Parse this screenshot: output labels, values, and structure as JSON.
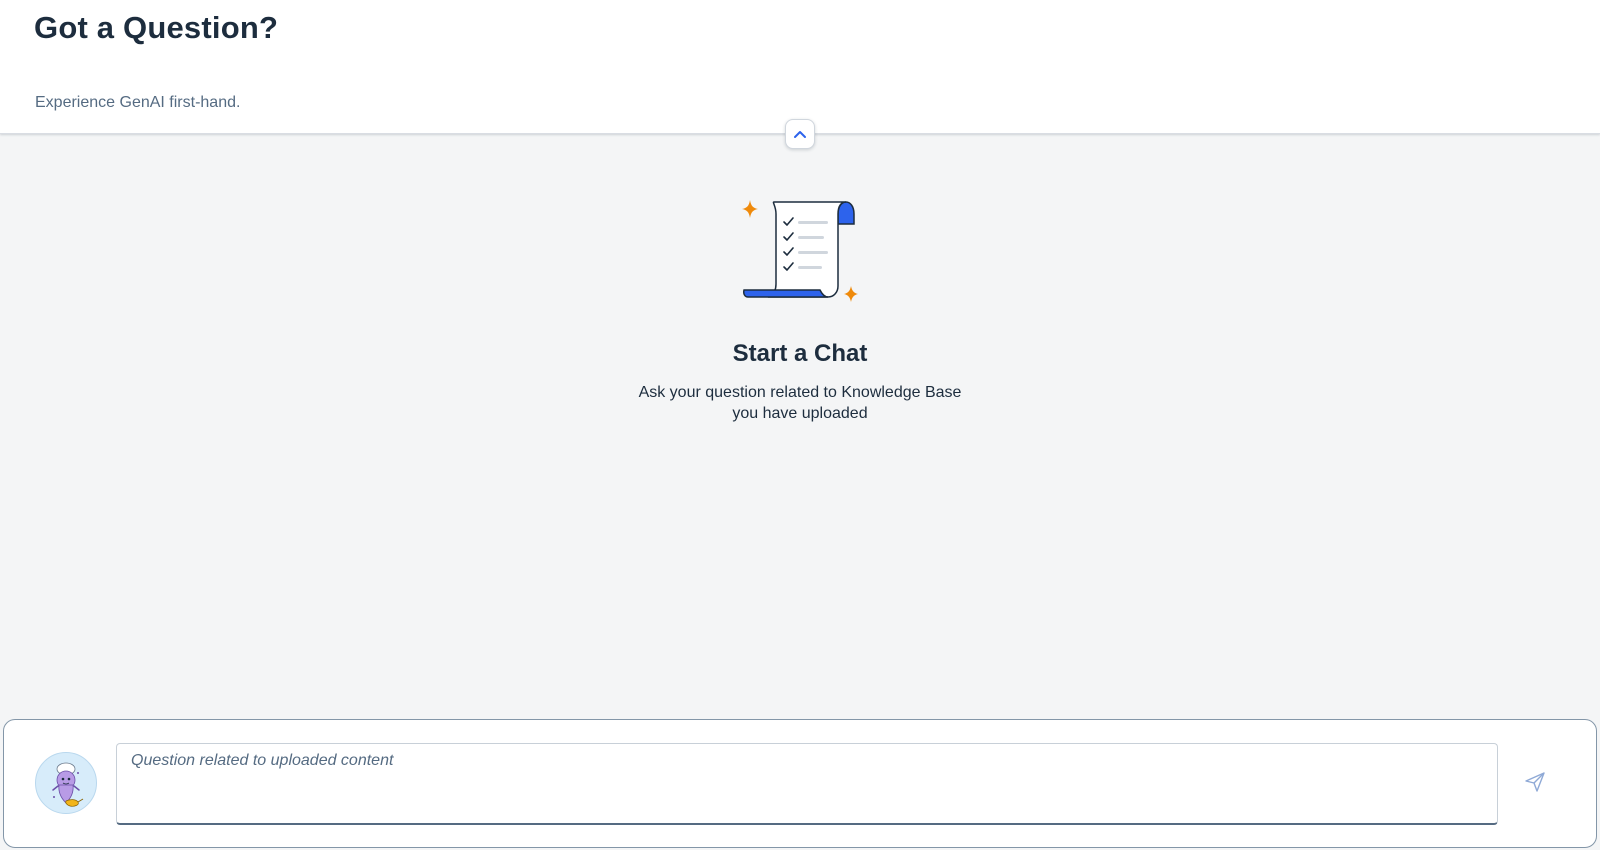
{
  "header": {
    "title": "Got a Question?",
    "subtitle": "Experience GenAI first-hand.",
    "collapse_icon": "chevron-up-icon"
  },
  "empty_state": {
    "illustration": "checklist-scroll-illustration",
    "title": "Start a Chat",
    "description": "Ask your question related to Knowledge Base you have uploaded"
  },
  "chat_bar": {
    "avatar_icon": "assistant-genie-avatar",
    "input": {
      "placeholder": "Question related to uploaded content",
      "value": ""
    },
    "send_icon": "paper-plane-send-icon"
  },
  "colors": {
    "accent_blue": "#2d63ec",
    "sparkle_orange": "#ef8a0b",
    "text_dark": "#1d2d3e",
    "text_muted": "#556b82",
    "page_bg": "#f4f5f6"
  }
}
